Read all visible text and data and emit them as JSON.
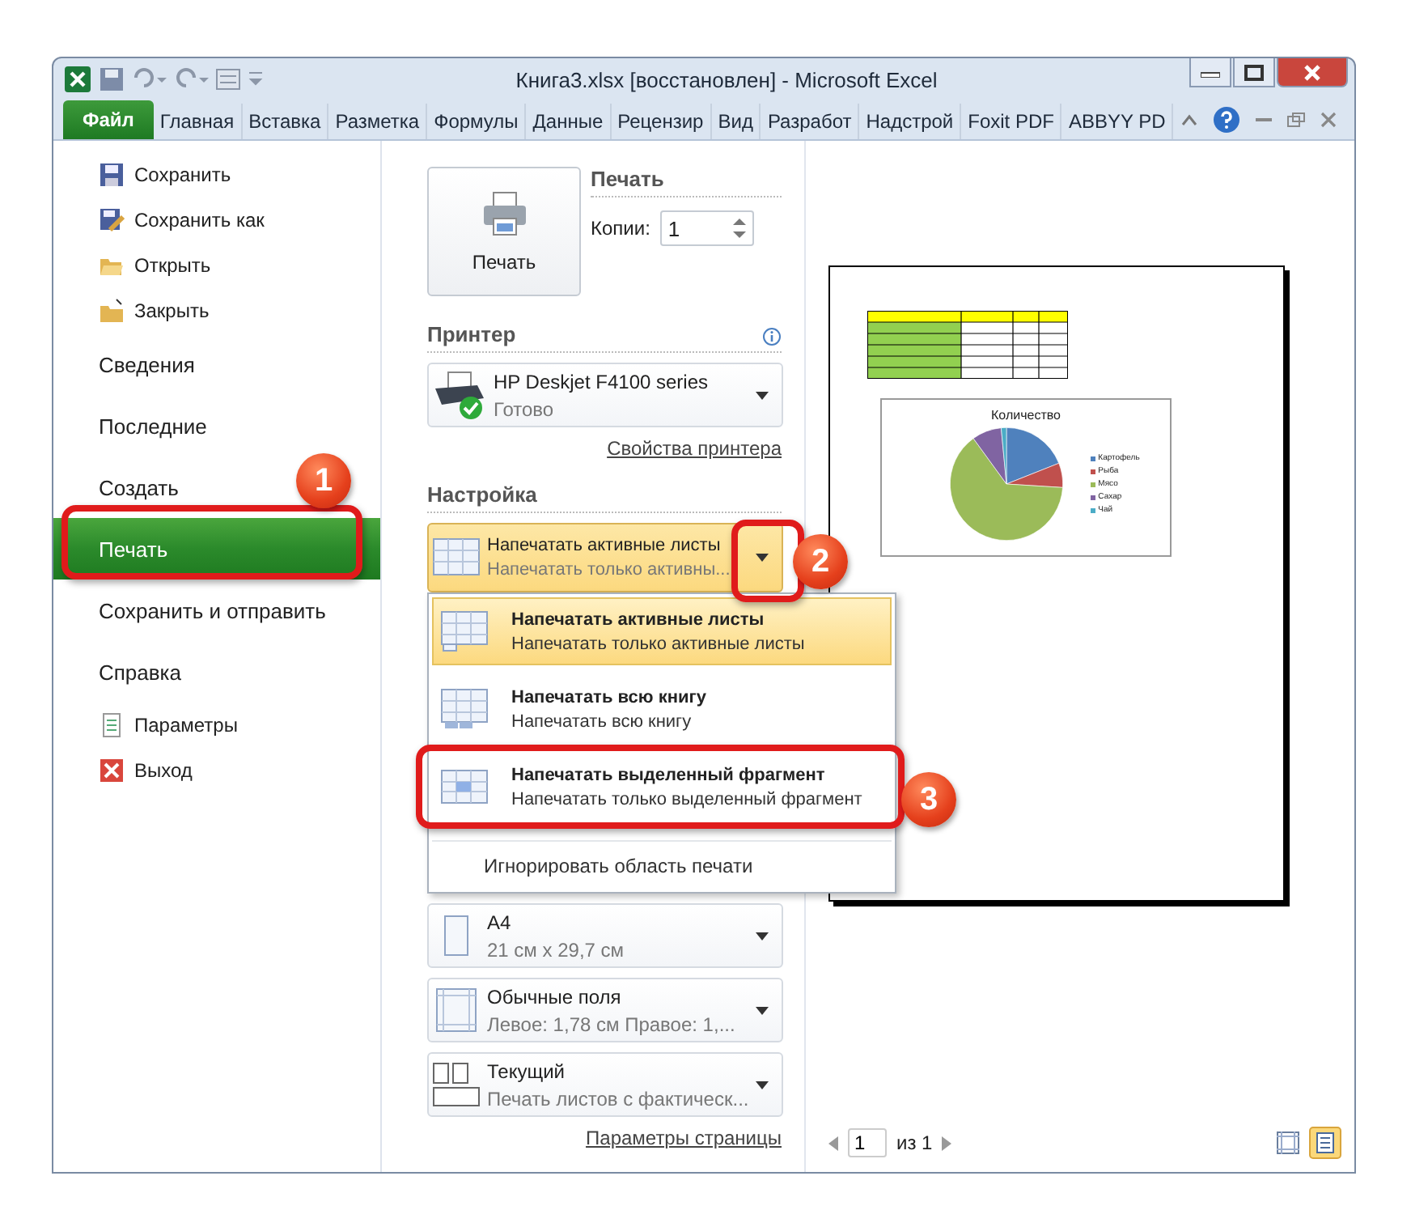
{
  "window": {
    "title": "Книга3.xlsx [восстановлен]  -  Microsoft Excel"
  },
  "ribbon_tabs": [
    {
      "label": "Файл",
      "selected": true
    },
    {
      "label": "Главная",
      "selected": false
    },
    {
      "label": "Вставка",
      "selected": false
    },
    {
      "label": "Разметка",
      "selected": false
    },
    {
      "label": "Формулы",
      "selected": false
    },
    {
      "label": "Данные",
      "selected": false
    },
    {
      "label": "Рецензир",
      "selected": false
    },
    {
      "label": "Вид",
      "selected": false
    },
    {
      "label": "Разработ",
      "selected": false
    },
    {
      "label": "Надстрой",
      "selected": false
    },
    {
      "label": "Foxit PDF",
      "selected": false
    },
    {
      "label": "ABBYY PD",
      "selected": false
    }
  ],
  "backstage_menu": [
    {
      "label": "Сохранить",
      "kind": "save",
      "selected": false
    },
    {
      "label": "Сохранить как",
      "kind": "saveas",
      "selected": false
    },
    {
      "label": "Открыть",
      "kind": "open",
      "selected": false
    },
    {
      "label": "Закрыть",
      "kind": "close",
      "selected": false
    },
    {
      "label": "Сведения",
      "kind": "section",
      "selected": false
    },
    {
      "label": "Последние",
      "kind": "section",
      "selected": false
    },
    {
      "label": "Создать",
      "kind": "section",
      "selected": false
    },
    {
      "label": "Печать",
      "kind": "section",
      "selected": true
    },
    {
      "label": "Сохранить и отправить",
      "kind": "section",
      "selected": false
    },
    {
      "label": "Справка",
      "kind": "section",
      "selected": false
    },
    {
      "label": "Параметры",
      "kind": "options",
      "selected": false
    },
    {
      "label": "Выход",
      "kind": "exit",
      "selected": false
    }
  ],
  "print": {
    "button": "Печать",
    "heading": "Печать",
    "copies_label": "Копии:",
    "copies_value": "1"
  },
  "printer": {
    "heading": "Принтер",
    "name": "HP Deskjet F4100 series",
    "status": "Готово",
    "link": "Свойства принтера"
  },
  "settings": {
    "heading": "Настройка",
    "open": true,
    "current": {
      "title": "Напечатать активные листы",
      "subtitle": "Напечатать только активны..."
    },
    "options": [
      {
        "title": "Напечатать активные листы",
        "subtitle": "Напечатать только активные листы",
        "kind": "sheets",
        "selected": true
      },
      {
        "title": "Напечатать всю книгу",
        "subtitle": "Напечатать всю книгу",
        "kind": "book",
        "selected": false
      },
      {
        "title": "Напечатать выделенный фрагмент",
        "subtitle": "Напечатать только выделенный фрагмент",
        "kind": "selection",
        "selected": false
      }
    ],
    "ignore_area": "Игнорировать область печати",
    "items": [
      {
        "title": "А4",
        "subtitle": "21 см x 29,7 см",
        "kind": "paper"
      },
      {
        "title": "Обычные поля",
        "subtitle": "Левое:  1,78 см    Правое:  1,...",
        "kind": "margins"
      },
      {
        "title": "Текущий",
        "subtitle": "Печать листов с фактическ...",
        "kind": "scaling"
      }
    ],
    "link": "Параметры страницы"
  },
  "preview": {
    "chart_title": "Количество",
    "legend": [
      {
        "label": "Картофель",
        "color": "#4f81bd"
      },
      {
        "label": "Рыба",
        "color": "#c0504d"
      },
      {
        "label": "Мясо",
        "color": "#9bbb59"
      },
      {
        "label": "Сахар",
        "color": "#8064a2"
      },
      {
        "label": "Чай",
        "color": "#4bacc6"
      }
    ],
    "page": "1",
    "of": "из 1"
  },
  "callouts": [
    {
      "number": "1"
    },
    {
      "number": "2"
    },
    {
      "number": "3"
    }
  ]
}
